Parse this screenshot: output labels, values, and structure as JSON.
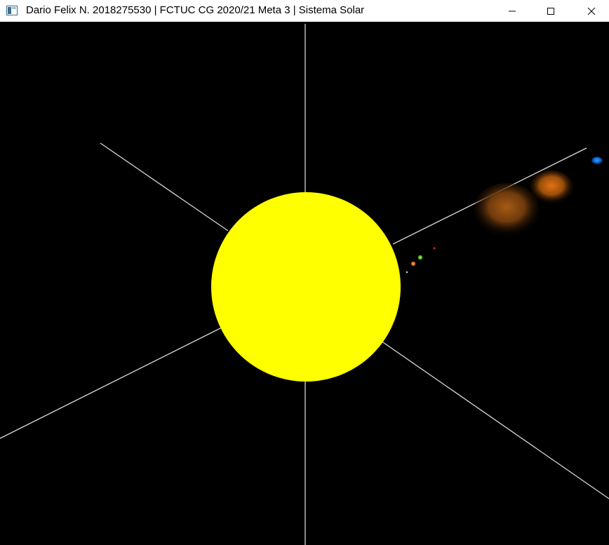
{
  "window": {
    "title": "Dario Felix N. 2018275530 | FCTUC CG 2020/21 Meta 3 | Sistema Solar",
    "icon": "app-window-icon",
    "controls": {
      "minimize": "minimize-icon",
      "maximize": "maximize-icon",
      "close": "close-icon"
    }
  },
  "scene": {
    "background": "#000000",
    "axis_color": "#d8d8d8",
    "sun_color": "#ffff00",
    "bodies": [
      {
        "name": "sun",
        "color": "#ffff00"
      },
      {
        "name": "planet-small-white",
        "color": "#cccccc"
      },
      {
        "name": "planet-orange-small",
        "color": "#ff8a1a"
      },
      {
        "name": "planet-green",
        "color": "#66ff33"
      },
      {
        "name": "planet-red",
        "color": "#cc2200"
      },
      {
        "name": "planet-large-brown",
        "color": "#8a4a10"
      },
      {
        "name": "planet-orange-large",
        "color": "#c8620a"
      },
      {
        "name": "planet-blue",
        "color": "#1a8cff"
      }
    ]
  }
}
